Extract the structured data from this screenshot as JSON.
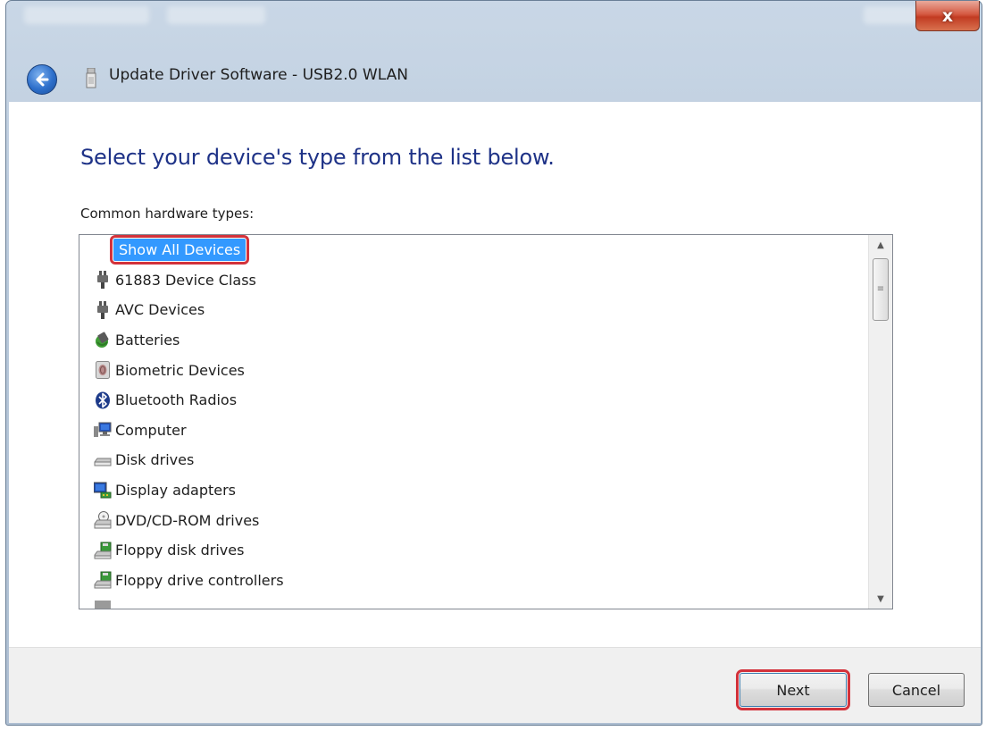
{
  "window": {
    "title": "Update Driver Software - USB2.0 WLAN",
    "close_label": "x"
  },
  "content": {
    "heading": "Select your device's type from the list below.",
    "list_label": "Common hardware types:",
    "items": [
      {
        "label": "Show All Devices",
        "icon": "none",
        "selected": true
      },
      {
        "label": "61883 Device Class",
        "icon": "plug-icon"
      },
      {
        "label": "AVC Devices",
        "icon": "plug-icon"
      },
      {
        "label": "Batteries",
        "icon": "battery-icon"
      },
      {
        "label": "Biometric Devices",
        "icon": "fingerprint-icon"
      },
      {
        "label": "Bluetooth Radios",
        "icon": "bluetooth-icon"
      },
      {
        "label": "Computer",
        "icon": "computer-icon"
      },
      {
        "label": "Disk drives",
        "icon": "disk-drive-icon"
      },
      {
        "label": "Display adapters",
        "icon": "display-adapter-icon"
      },
      {
        "label": "DVD/CD-ROM drives",
        "icon": "dvd-drive-icon"
      },
      {
        "label": "Floppy disk drives",
        "icon": "floppy-drive-icon"
      },
      {
        "label": "Floppy drive controllers",
        "icon": "floppy-controller-icon"
      }
    ]
  },
  "footer": {
    "next_label": "Next",
    "cancel_label": "Cancel"
  },
  "colors": {
    "heading": "#1e3287",
    "selection": "#3399ff",
    "highlight_outline": "#d3323b"
  }
}
